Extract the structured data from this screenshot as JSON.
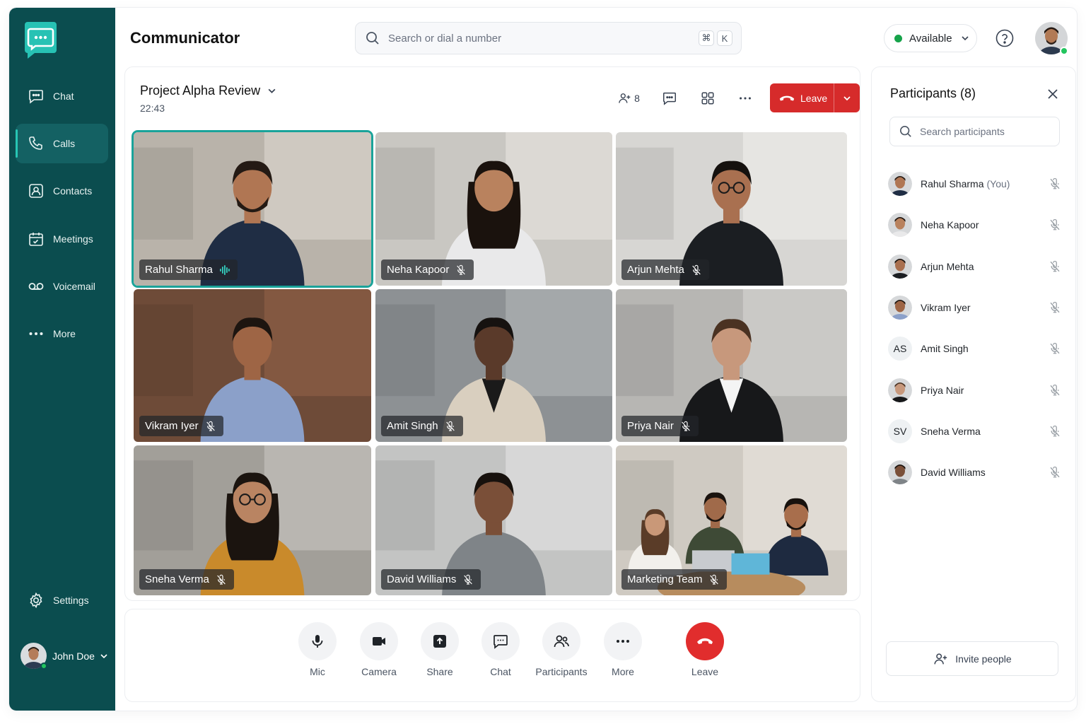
{
  "app": {
    "title": "Communicator"
  },
  "sidebar": {
    "items": [
      {
        "label": "Chat",
        "icon": "chat-icon"
      },
      {
        "label": "Calls",
        "icon": "phone-icon",
        "active": true
      },
      {
        "label": "Contacts",
        "icon": "contacts-icon"
      },
      {
        "label": "Meetings",
        "icon": "calendar-icon"
      },
      {
        "label": "Voicemail",
        "icon": "voicemail-icon"
      },
      {
        "label": "More",
        "icon": "more-dots-icon"
      }
    ],
    "settings_label": "Settings",
    "user_name": "John Doe"
  },
  "header": {
    "search_placeholder": "Search or dial a number",
    "shortcut_key_1": "⌘",
    "shortcut_key_2": "K",
    "status_label": "Available",
    "status_color": "#16a34a"
  },
  "call": {
    "title": "Project Alpha Review",
    "timer": "22:43",
    "participant_count": "8",
    "leave_label": "Leave"
  },
  "tiles": [
    {
      "name": "Rahul Sharma",
      "speaking": true,
      "muted": false
    },
    {
      "name": "Neha Kapoor",
      "muted": true
    },
    {
      "name": "Arjun Mehta",
      "muted": true
    },
    {
      "name": "Vikram Iyer",
      "muted": true
    },
    {
      "name": "Amit Singh",
      "muted": true
    },
    {
      "name": "Priya Nair",
      "muted": true
    },
    {
      "name": "Sneha Verma",
      "muted": true
    },
    {
      "name": "David Williams",
      "muted": true
    },
    {
      "name": "Marketing Team",
      "muted": true
    }
  ],
  "controls": [
    {
      "label": "Mic",
      "icon": "mic-icon"
    },
    {
      "label": "Camera",
      "icon": "camera-icon"
    },
    {
      "label": "Share",
      "icon": "share-screen-icon"
    },
    {
      "label": "Chat",
      "icon": "chat-icon"
    },
    {
      "label": "Participants",
      "icon": "participants-icon"
    },
    {
      "label": "More",
      "icon": "more-dots-icon"
    },
    {
      "label": "Leave",
      "icon": "hang-up-icon"
    }
  ],
  "panel": {
    "title": "Participants (8)",
    "search_placeholder": "Search participants",
    "participants": [
      {
        "name": "Rahul Sharma",
        "suffix": "(You)"
      },
      {
        "name": "Neha Kapoor"
      },
      {
        "name": "Arjun Mehta"
      },
      {
        "name": "Vikram Iyer"
      },
      {
        "name": "Amit Singh",
        "initials": "AS"
      },
      {
        "name": "Priya Nair"
      },
      {
        "name": "Sneha Verma",
        "initials": "SV"
      },
      {
        "name": "David Williams"
      }
    ],
    "invite_label": "Invite people"
  },
  "colors": {
    "sidebar": "#0b4d4f",
    "accent": "#1aa39a",
    "danger": "#d62b2b"
  }
}
